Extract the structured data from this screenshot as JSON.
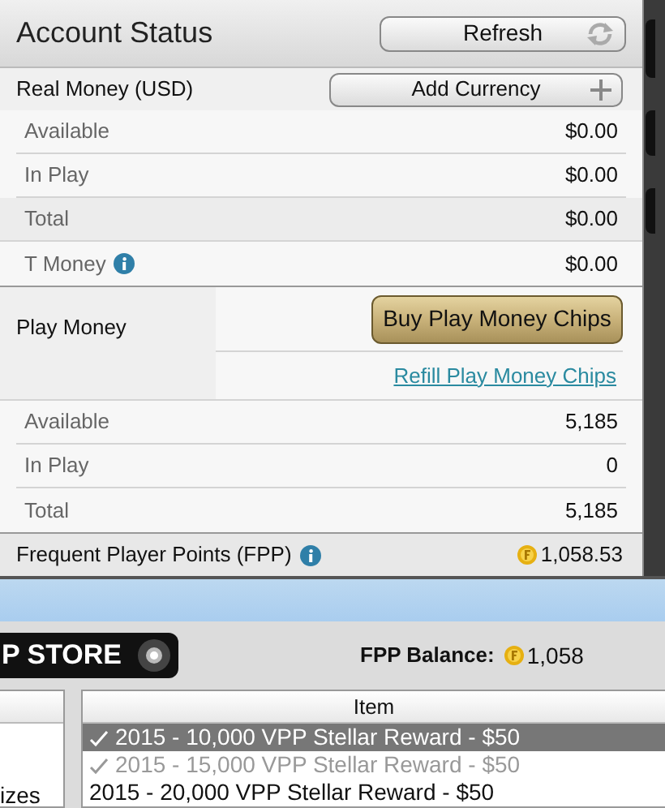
{
  "account_status": {
    "title": "Account Status",
    "refresh_button": "Refresh",
    "real_money": {
      "label": "Real Money (USD)",
      "add_button": "Add Currency",
      "rows": [
        {
          "label": "Available",
          "value": "$0.00",
          "shaded": false,
          "info": false
        },
        {
          "label": "In Play",
          "value": "$0.00",
          "shaded": false,
          "info": false
        },
        {
          "label": "Total",
          "value": "$0.00",
          "shaded": true,
          "info": false
        },
        {
          "label": "T Money",
          "value": "$0.00",
          "shaded": false,
          "info": true
        }
      ]
    },
    "play_money": {
      "label": "Play Money",
      "buy_button": "Buy Play Money Chips",
      "refill_link": "Refill Play Money Chips",
      "rows": [
        {
          "label": "Available",
          "value": "5,185"
        },
        {
          "label": "In Play",
          "value": "0"
        },
        {
          "label": "Total",
          "value": "5,185"
        }
      ]
    },
    "fpp": {
      "label": "Frequent Player Points (FPP)",
      "value": "1,058.53"
    }
  },
  "store": {
    "banner": "P STORE",
    "balance_label": "FPP Balance:",
    "balance_value": "1,058",
    "left_list": {
      "items": [
        "izes"
      ]
    },
    "item_table": {
      "column": "Item",
      "rows": [
        {
          "text": "2015 - 10,000 VPP Stellar Reward - $50",
          "checked": true,
          "selected": true,
          "disabled": false
        },
        {
          "text": "2015 - 15,000 VPP Stellar Reward - $50",
          "checked": true,
          "selected": false,
          "disabled": true
        },
        {
          "text": "2015 - 20,000 VPP Stellar Reward - $50",
          "checked": false,
          "selected": false,
          "disabled": false
        }
      ]
    }
  }
}
